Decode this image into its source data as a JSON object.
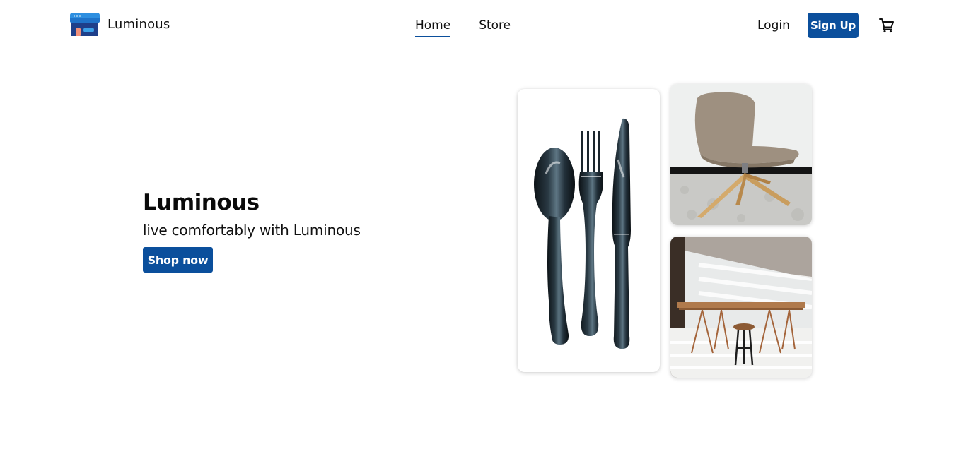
{
  "brand": {
    "name": "Luminous",
    "logo_icon": "store-icon"
  },
  "nav": {
    "links": [
      {
        "label": "Home",
        "active": true
      },
      {
        "label": "Store",
        "active": false
      }
    ],
    "login_label": "Login",
    "signup_label": "Sign Up",
    "cart_icon": "cart-icon"
  },
  "hero": {
    "title": "Luminous",
    "subtitle": "live comfortably with Luminous",
    "cta_label": "Shop now"
  },
  "gallery": [
    {
      "name": "cutlery-image"
    },
    {
      "name": "chair-image"
    },
    {
      "name": "table-image"
    }
  ],
  "colors": {
    "primary": "#0b4f9c",
    "text": "#111111",
    "background": "#ffffff"
  }
}
